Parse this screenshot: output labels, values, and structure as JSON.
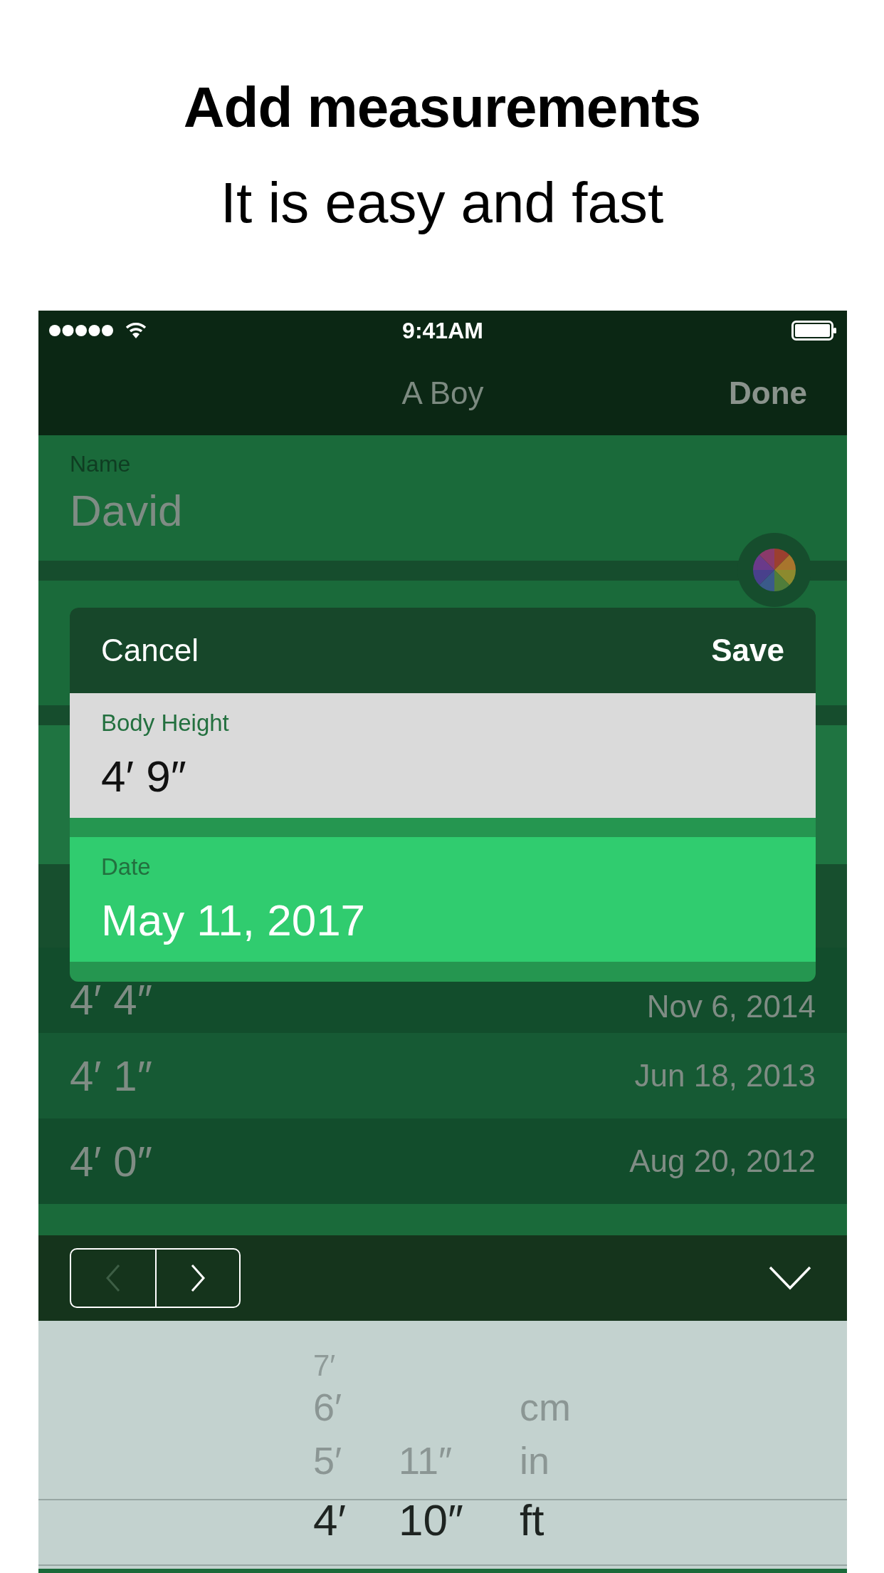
{
  "header": {
    "title": "Add measurements",
    "subtitle": "It is easy and fast"
  },
  "status_bar": {
    "time": "9:41AM"
  },
  "nav": {
    "title": "A Boy",
    "done": "Done"
  },
  "form": {
    "name_label": "Name",
    "name_value": "David"
  },
  "measurements": [
    {
      "height": "4′ 4″",
      "date": "Nov 6, 2014"
    },
    {
      "height": "4′ 1″",
      "date": "Jun 18, 2013"
    },
    {
      "height": "4′ 0″",
      "date": "Aug 20, 2012"
    }
  ],
  "dialog": {
    "cancel": "Cancel",
    "save": "Save",
    "fields": [
      {
        "label": "Body Height",
        "value": "4′ 9″",
        "selected": false
      },
      {
        "label": "Date",
        "value": "May 11, 2017",
        "selected": true
      }
    ]
  },
  "toolbar": {
    "previous": {
      "disabled": true
    },
    "next": {
      "disabled": false
    }
  },
  "picker": {
    "columns": [
      {
        "items": [
          {
            "label": "7′",
            "selected": false
          },
          {
            "label": "6′",
            "selected": false
          },
          {
            "label": "5′",
            "selected": false
          },
          {
            "label": "4′",
            "selected": true
          }
        ]
      },
      {
        "items": [
          {
            "label": "11″",
            "selected": false
          },
          {
            "label": "10″",
            "selected": true
          }
        ]
      },
      {
        "items": [
          {
            "label": "cm",
            "selected": false
          },
          {
            "label": "in",
            "selected": false
          },
          {
            "label": "ft",
            "selected": true
          }
        ]
      }
    ]
  }
}
